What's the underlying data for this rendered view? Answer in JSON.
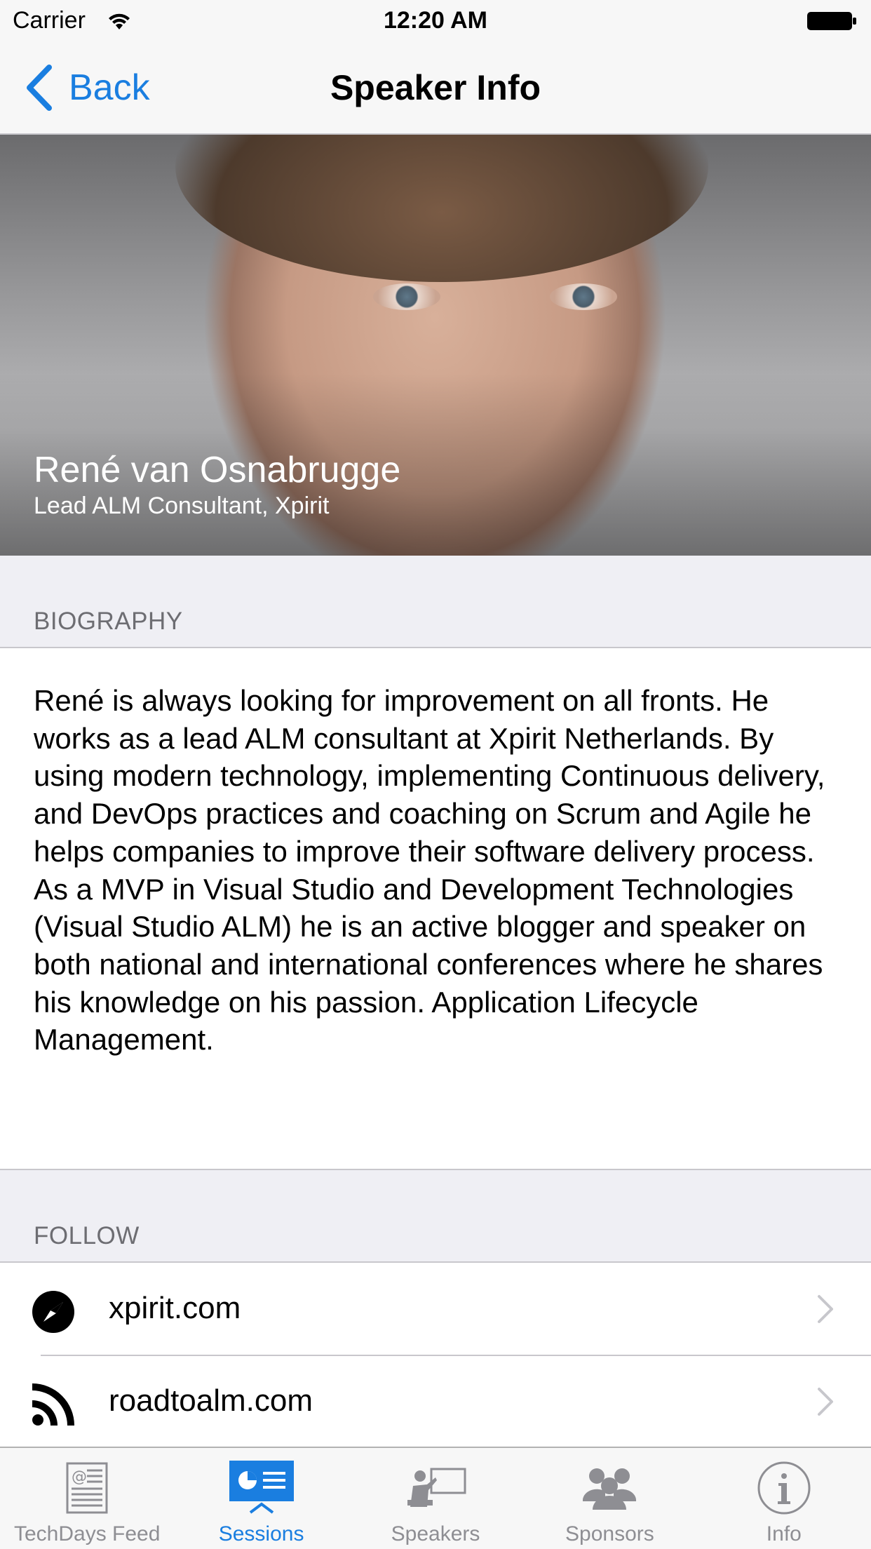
{
  "status_bar": {
    "carrier": "Carrier",
    "time": "12:20 AM"
  },
  "nav": {
    "back_label": "Back",
    "title": "Speaker Info"
  },
  "speaker": {
    "name": "René van Osnabrugge",
    "subtitle": "Lead ALM Consultant, Xpirit"
  },
  "biography": {
    "header": "BIOGRAPHY",
    "text": "René is always looking for improvement on all fronts. He works as a lead ALM consultant at Xpirit Netherlands. By using modern technology, implementing Continuous delivery, and DevOps practices and coaching on Scrum and Agile he helps companies to improve their software delivery process. As a MVP in Visual Studio and Development Technologies (Visual Studio ALM) he is an active blogger and speaker on both national and international conferences where he shares his knowledge on his passion. Application Lifecycle Management."
  },
  "follow": {
    "header": "FOLLOW",
    "items": [
      {
        "label": "xpirit.com",
        "icon": "compass-icon"
      },
      {
        "label": "roadtoalm.com",
        "icon": "rss-icon"
      }
    ]
  },
  "tabs": [
    {
      "label": "TechDays Feed",
      "icon": "news-feed-icon",
      "active": false
    },
    {
      "label": "Sessions",
      "icon": "sessions-presentation-icon",
      "active": true
    },
    {
      "label": "Speakers",
      "icon": "speaker-podium-icon",
      "active": false
    },
    {
      "label": "Sponsors",
      "icon": "group-people-icon",
      "active": false
    },
    {
      "label": "Info",
      "icon": "info-icon",
      "active": false
    }
  ],
  "colors": {
    "accent": "#1a7ee0",
    "inactive": "#8e8e93",
    "group_bg": "#efeff4"
  }
}
